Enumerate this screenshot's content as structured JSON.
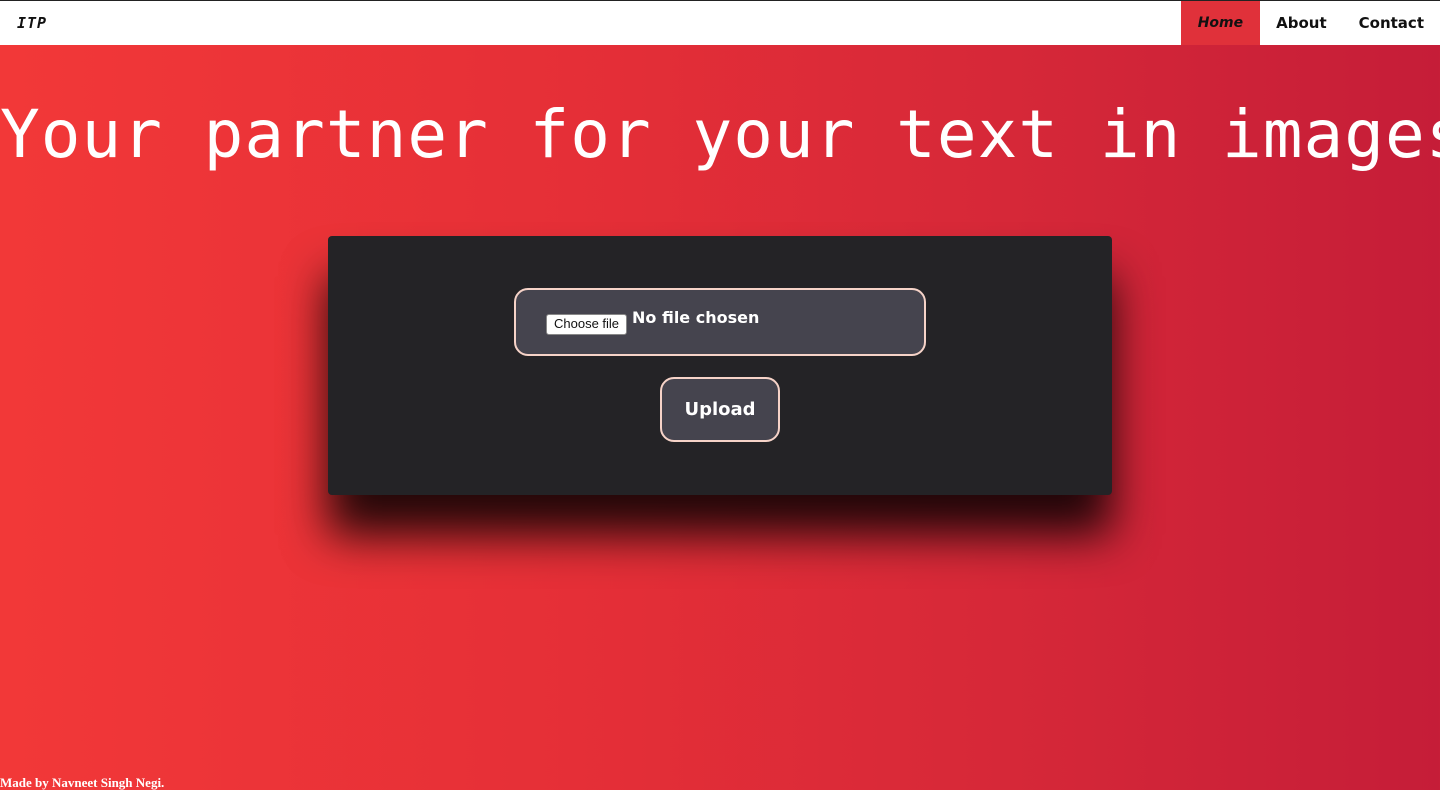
{
  "navbar": {
    "brand": "ITP",
    "links": [
      {
        "label": "Home",
        "active": true
      },
      {
        "label": "About",
        "active": false
      },
      {
        "label": "Contact",
        "active": false
      }
    ]
  },
  "hero": {
    "title": "Your partner for your text in images!"
  },
  "upload_form": {
    "choose_file_label": "Choose file",
    "file_status": "No file chosen",
    "upload_label": "Upload"
  },
  "footer": {
    "text": "Made by Navneet Singh Negi."
  },
  "colors": {
    "gradient_start": "#f23838",
    "gradient_end": "#c51d38",
    "card_bg": "#242326",
    "field_bg": "#45444e",
    "field_border": "#f6d3c8",
    "active_nav": "#e0313a"
  }
}
